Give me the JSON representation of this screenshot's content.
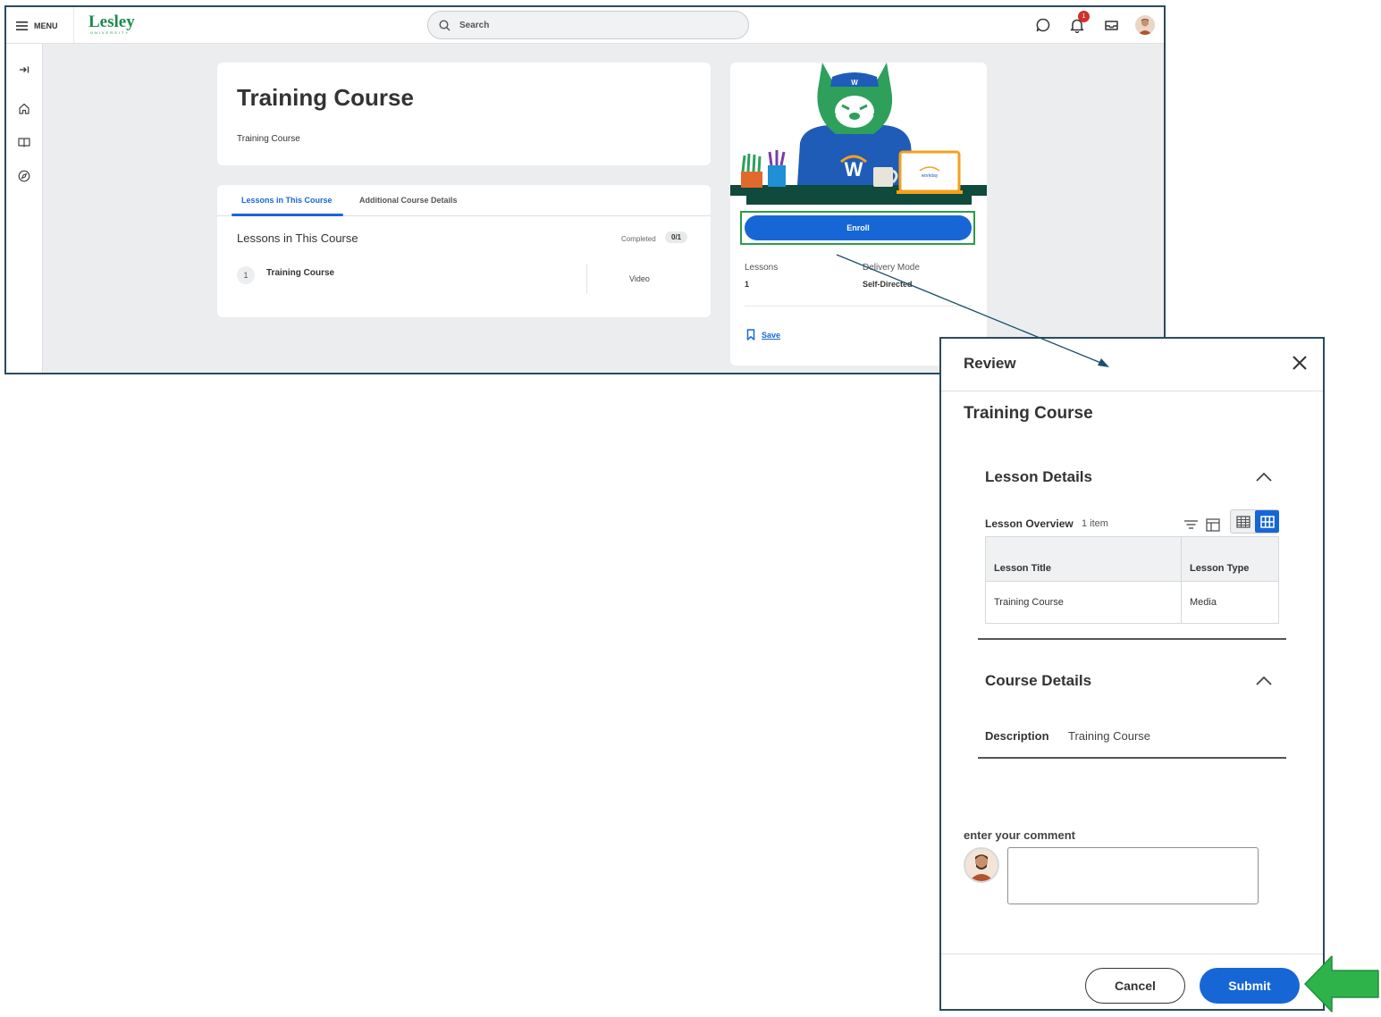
{
  "app": {
    "menu_label": "MENU",
    "logo_text": "Lesley",
    "logo_subtext": "UNIVERSITY",
    "search_placeholder": "Search",
    "notification_count": "1"
  },
  "course": {
    "title": "Training Course",
    "subtitle": "Training Course",
    "tabs": [
      {
        "label": "Lessons in This Course",
        "active": true
      },
      {
        "label": "Additional Course Details",
        "active": false
      }
    ],
    "lessons_heading": "Lessons in This Course",
    "completed_label": "Completed",
    "completed_value": "0/1",
    "lessons": [
      {
        "number": "1",
        "title": "Training Course",
        "type": "Video"
      }
    ]
  },
  "side_panel": {
    "enroll_label": "Enroll",
    "lessons_label": "Lessons",
    "lessons_value": "1",
    "delivery_label": "Delivery Mode",
    "delivery_value": "Self-Directed",
    "save_label": "Save"
  },
  "review_dialog": {
    "title": "Review",
    "course_title": "Training Course",
    "lesson_details": {
      "title": "Lesson Details",
      "overview_label": "Lesson Overview",
      "overview_count": "1 item",
      "columns": [
        "Lesson Title",
        "Lesson Type"
      ],
      "rows": [
        [
          "Training Course",
          "Media"
        ]
      ]
    },
    "course_details": {
      "title": "Course Details",
      "description_label": "Description",
      "description_value": "Training Course"
    },
    "comment_label": "enter your comment",
    "comment_value": "",
    "cancel_label": "Cancel",
    "submit_label": "Submit"
  },
  "colors": {
    "primary_blue": "#1766d6",
    "brand_green": "#1e8a4c",
    "highlight_green": "#2d9c49",
    "frame_border": "#2b4a5e"
  }
}
